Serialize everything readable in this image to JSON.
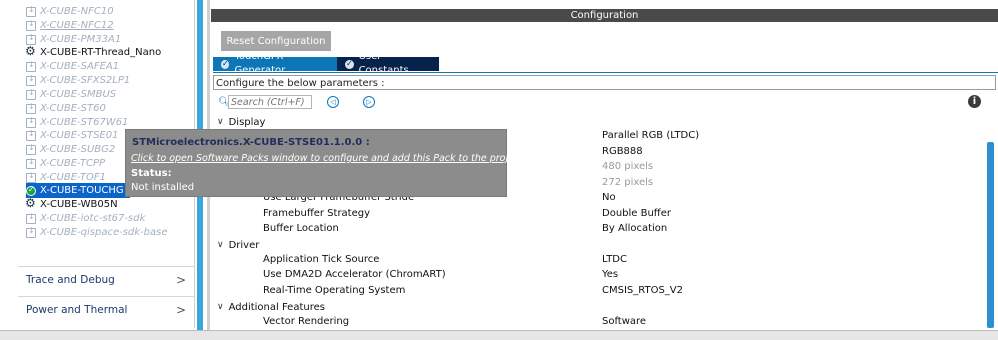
{
  "sidebar": {
    "packs": [
      {
        "label": "X-CUBE-NFC10",
        "state": "gray"
      },
      {
        "label": "X-CUBE-NFC12",
        "state": "gray-underline"
      },
      {
        "label": "X-CUBE-PM33A1",
        "state": "gray"
      },
      {
        "label": "X-CUBE-RT-Thread_Nano",
        "state": "installed"
      },
      {
        "label": "X-CUBE-SAFEA1",
        "state": "gray"
      },
      {
        "label": "X-CUBE-SFXS2LP1",
        "state": "gray"
      },
      {
        "label": "X-CUBE-SMBUS",
        "state": "gray"
      },
      {
        "label": "X-CUBE-ST60",
        "state": "gray"
      },
      {
        "label": "X-CUBE-ST67W61",
        "state": "gray"
      },
      {
        "label": "X-CUBE-STSE01",
        "state": "gray"
      },
      {
        "label": "X-CUBE-SUBG2",
        "state": "gray"
      },
      {
        "label": "X-CUBE-TCPP",
        "state": "gray"
      },
      {
        "label": "X-CUBE-TOF1",
        "state": "gray"
      },
      {
        "label": "X-CUBE-TOUCHG",
        "state": "selected"
      },
      {
        "label": "X-CUBE-WB05N",
        "state": "installed"
      },
      {
        "label": "X-CUBE-iotc-st67-sdk",
        "state": "gray"
      },
      {
        "label": "X-CUBE-qispace-sdk-base",
        "state": "gray"
      }
    ],
    "sections": [
      {
        "label": "Trace and Debug",
        "chevron": ">"
      },
      {
        "label": "Power and Thermal",
        "chevron": ">"
      }
    ]
  },
  "config": {
    "title": "Configuration",
    "reset_label": "Reset Configuration",
    "tabs": [
      {
        "label": "TouchGFX Generator"
      },
      {
        "label": "User Constants"
      }
    ],
    "params_title": "Configure the below parameters :",
    "search_placeholder": "Search (Ctrl+F)",
    "prev_icon": "◁",
    "next_icon": "▷",
    "info_icon": "i",
    "groups": [
      {
        "label": "Display",
        "chevron": "∨"
      },
      {
        "label": "Driver",
        "chevron": "∨"
      },
      {
        "label": "Additional Features",
        "chevron": "∨"
      }
    ],
    "rows": [
      {
        "key": "",
        "value": "Parallel RGB (LTDC)"
      },
      {
        "key": "",
        "value": "RGB888"
      },
      {
        "key": "",
        "value": "480 pixels"
      },
      {
        "key": "",
        "value": "272 pixels"
      },
      {
        "key": "Use Larger Framebuffer Stride",
        "value": "No"
      },
      {
        "key": "Framebuffer Strategy",
        "value": "Double Buffer"
      },
      {
        "key": "Buffer Location",
        "value": "By Allocation"
      },
      {
        "key": "Application Tick Source",
        "value": "LTDC"
      },
      {
        "key": "Use DMA2D Accelerator (ChromART)",
        "value": "Yes"
      },
      {
        "key": "Real-Time Operating System",
        "value": "CMSIS_RTOS_V2"
      },
      {
        "key": "Vector Rendering",
        "value": "Software"
      }
    ]
  },
  "tooltip": {
    "title": "STMicroelectronics.X-CUBE-STSE01.1.0.0 :",
    "link": "Click to open Software Packs window to configure and add this Pack to the project",
    "status_label": "Status:",
    "status": "Not installed"
  },
  "colors": {
    "accent": "#0c76b7",
    "tab_dark": "#07224b",
    "selected_bg": "#0b64c8",
    "scrollbar": "#39a6dd"
  }
}
